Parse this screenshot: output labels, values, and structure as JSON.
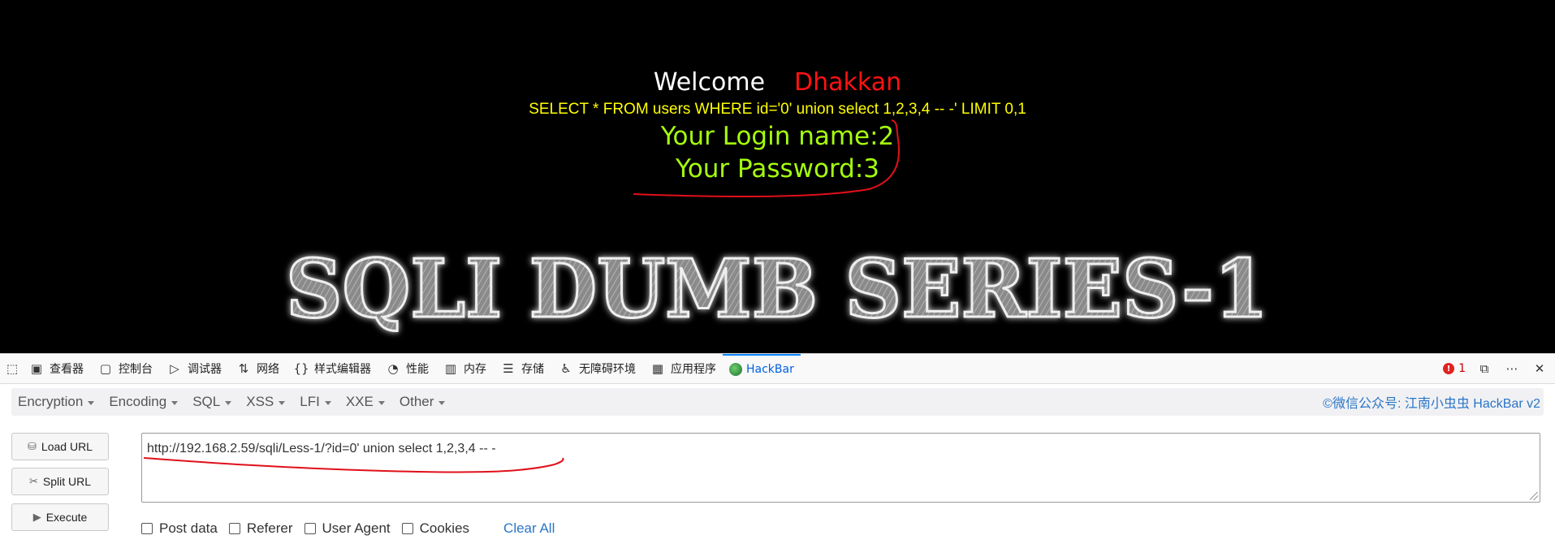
{
  "page": {
    "welcome_label": "Welcome",
    "welcome_name": "Dhakkan",
    "query": "SELECT * FROM users WHERE id='0' union select 1,2,3,4 -- -' LIMIT 0,1",
    "login_name": "Your Login name:2",
    "password": "Your Password:3",
    "logo_text": "SQLI DUMB SERIES-1"
  },
  "devtools": {
    "tabs": [
      {
        "label": "查看器",
        "icon": "inspector-icon"
      },
      {
        "label": "控制台",
        "icon": "console-icon"
      },
      {
        "label": "调试器",
        "icon": "debugger-icon"
      },
      {
        "label": "网络",
        "icon": "network-icon"
      },
      {
        "label": "样式编辑器",
        "icon": "style-editor-icon"
      },
      {
        "label": "性能",
        "icon": "performance-icon"
      },
      {
        "label": "内存",
        "icon": "memory-icon"
      },
      {
        "label": "存储",
        "icon": "storage-icon"
      },
      {
        "label": "无障碍环境",
        "icon": "accessibility-icon"
      },
      {
        "label": "应用程序",
        "icon": "application-icon"
      },
      {
        "label": "HackBar",
        "icon": "hackbar-icon"
      }
    ],
    "error_count": "1"
  },
  "hackbar": {
    "menus": [
      "Encryption",
      "Encoding",
      "SQL",
      "XSS",
      "LFI",
      "XXE",
      "Other"
    ],
    "credit": "©微信公众号: 江南小虫虫 HackBar v2",
    "buttons": {
      "load": "Load URL",
      "split": "Split URL",
      "execute": "Execute"
    },
    "url_value": "http://192.168.2.59/sqli/Less-1/?id=0' union select 1,2,3,4 -- -",
    "options": {
      "post": "Post data",
      "referer": "Referer",
      "user_agent": "User Agent",
      "cookies": "Cookies"
    },
    "clear_all": "Clear All"
  },
  "colors": {
    "welcome_name": "#ff1212",
    "query": "#ffff00",
    "result": "#a5ff0d",
    "annotation": "#e0101a",
    "link": "#2a76c6"
  }
}
